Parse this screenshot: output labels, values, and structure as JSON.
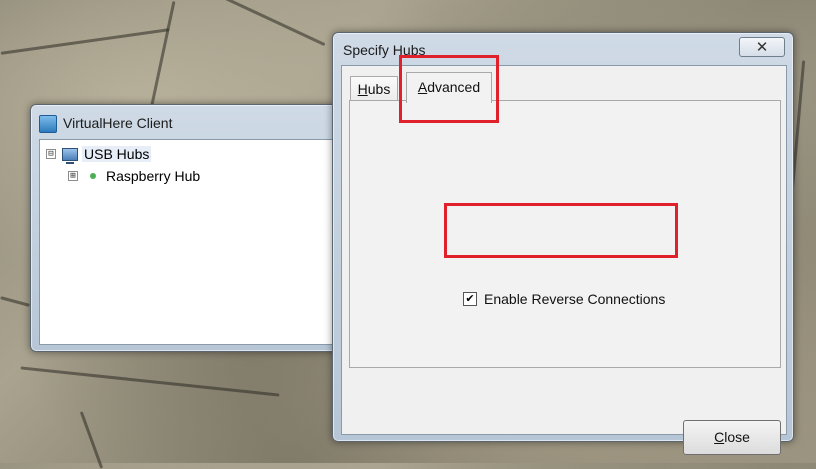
{
  "virtualhere": {
    "title": "VirtualHere Client",
    "tree": {
      "root_expander": "⊟",
      "root_label": "USB Hubs",
      "child_expander": "⊞",
      "child_label": "Raspberry Hub"
    }
  },
  "dialog": {
    "title": "Specify Hubs",
    "close_glyph": "✕",
    "tabs": [
      {
        "label": "Hubs",
        "underline": "H",
        "rest": "ubs"
      },
      {
        "label": "Advanced",
        "underline": "A",
        "rest": "dvanced"
      }
    ],
    "checkbox": {
      "label": "Enable Reverse Connections",
      "checked": true,
      "mark": "✔"
    },
    "close_button": {
      "label": "Close",
      "underline": "C",
      "rest": "lose"
    }
  },
  "colors": {
    "highlight": "#e0202a",
    "node_dot": "#4caf50"
  },
  "icons": [
    "virtualhere-app-icon",
    "usb-hubs-computer-icon",
    "online-status-dot-icon",
    "window-close-icon",
    "checkbox-checked-icon"
  ]
}
